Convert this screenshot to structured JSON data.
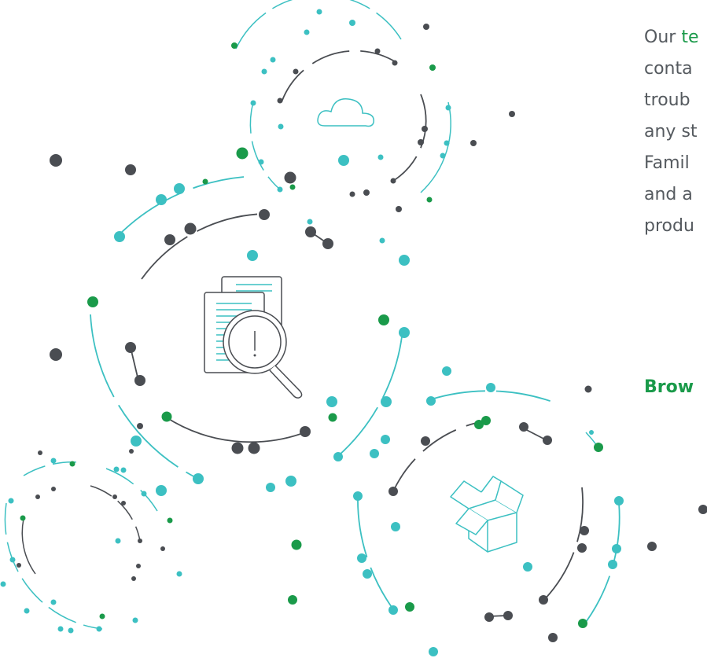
{
  "paragraph": {
    "lead": "Our ",
    "link": "te",
    "lines": [
      "conta",
      "troub",
      "any st",
      "Famil",
      "and a",
      "produ"
    ]
  },
  "cta": {
    "label": "Brow"
  },
  "icons": [
    "cloud-icon",
    "document-search-icon",
    "open-box-icon"
  ],
  "colors": {
    "teal": "#3cc0c2",
    "dark": "#4a4d52",
    "green": "#1a9a4a",
    "text": "#555a5f"
  }
}
